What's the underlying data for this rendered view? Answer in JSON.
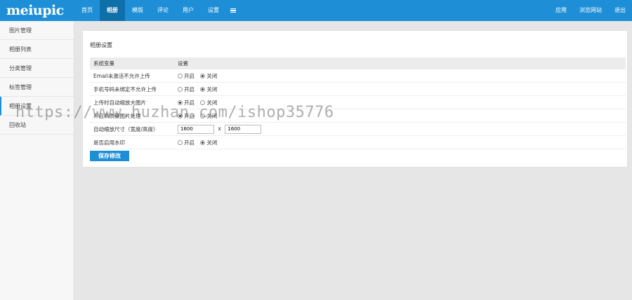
{
  "header": {
    "logo": "meiupic",
    "nav": [
      {
        "label": "首页"
      },
      {
        "label": "相册",
        "active": true
      },
      {
        "label": "模版"
      },
      {
        "label": "评论"
      },
      {
        "label": "用户"
      },
      {
        "label": "设置"
      }
    ],
    "menu_icon": "menu-icon",
    "right_nav": [
      {
        "label": "应用"
      },
      {
        "label": "浏览网站"
      },
      {
        "label": "退出"
      }
    ]
  },
  "sidebar": {
    "items": [
      {
        "label": "图片管理"
      },
      {
        "label": "相册列表"
      },
      {
        "label": "分类管理"
      },
      {
        "label": "标签管理"
      },
      {
        "label": "相册设置",
        "active": true
      },
      {
        "label": "回收站"
      }
    ]
  },
  "panel": {
    "title": "相册设置",
    "columns": [
      "系统变量",
      "设置"
    ],
    "rows": [
      {
        "label": "Email未激活不允许上传",
        "on": "开启",
        "off": "关闭",
        "value": "off"
      },
      {
        "label": "手机号码未绑定不允许上传",
        "on": "开启",
        "off": "关闭",
        "value": "off"
      },
      {
        "label": "上传时自动缩放大图片",
        "on": "开启",
        "off": "关闭",
        "value": "on"
      },
      {
        "label": "开启高质量图片处理",
        "on": "开启",
        "off": "关闭",
        "value": "on"
      },
      {
        "label": "自动缩放尺寸（宽度/高度）",
        "width": "1600",
        "times": "x",
        "height": "1600"
      },
      {
        "label": "是否启用水印",
        "on": "开启",
        "off": "关闭",
        "value": "off"
      }
    ],
    "save_label": "保存修改"
  },
  "watermark": "https://www.huzhan.com/ishop35776",
  "colors": {
    "accent": "#1e8fd6",
    "nav_active": "#0f6fa9"
  }
}
